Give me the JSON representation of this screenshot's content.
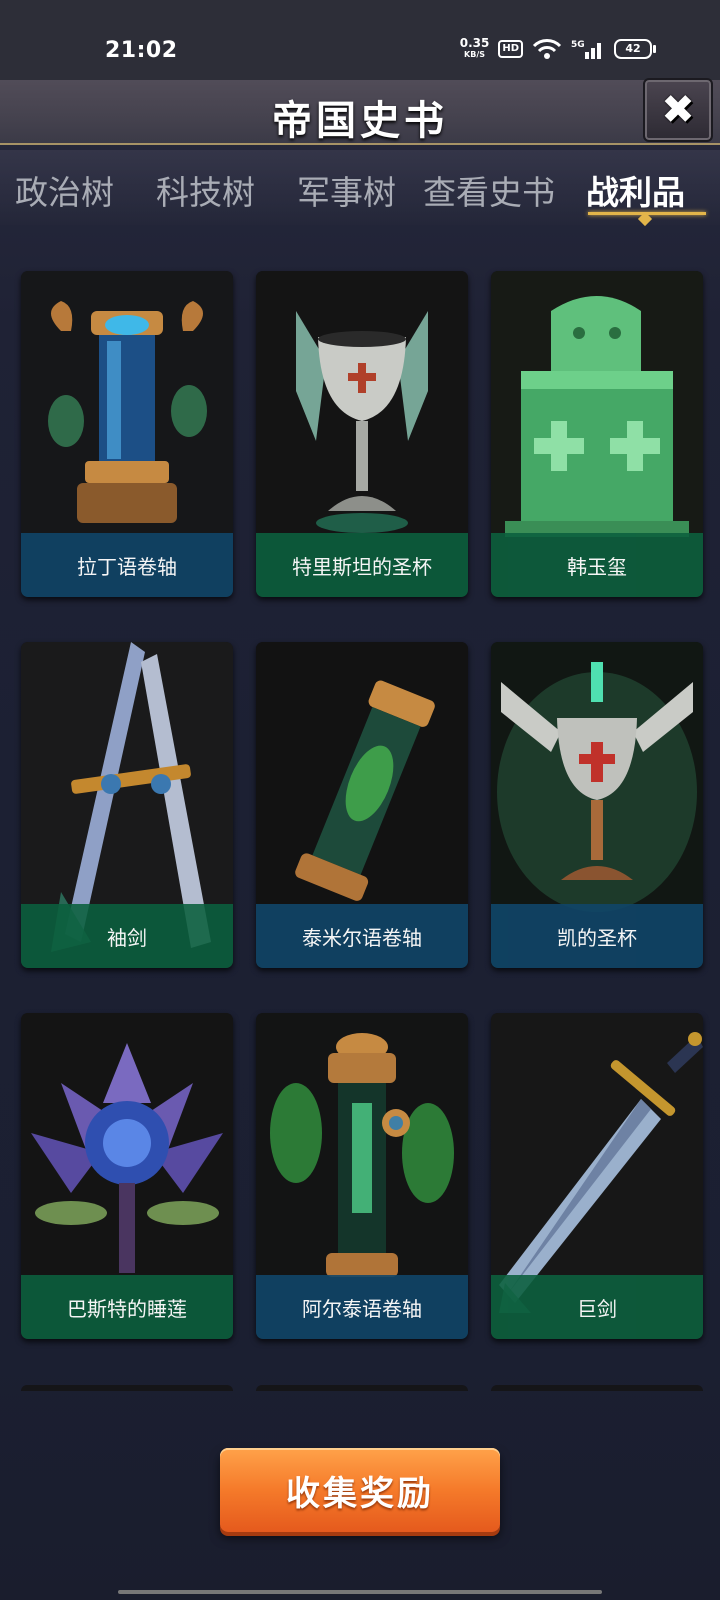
{
  "status_bar": {
    "time": "21:02",
    "net_speed": "0.35",
    "net_unit": "KB/S",
    "hd": "HD",
    "network": "5G",
    "battery": "42"
  },
  "header": {
    "title": "帝国史书",
    "close_label": "✖"
  },
  "tabs": [
    {
      "label": "政治树",
      "active": false
    },
    {
      "label": "科技树",
      "active": false
    },
    {
      "label": "军事树",
      "active": false
    },
    {
      "label": "查看史书",
      "active": false
    },
    {
      "label": "战利品",
      "active": true
    }
  ],
  "items": [
    {
      "name": "拉丁语卷轴",
      "icon": "scroll-icon",
      "label_color": "#104669"
    },
    {
      "name": "特里斯坦的圣杯",
      "icon": "grail-icon",
      "label_color": "#0c603e"
    },
    {
      "name": "韩玉玺",
      "icon": "jade-seal-icon",
      "label_color": "#0c603e"
    },
    {
      "name": "袖剑",
      "icon": "sword-icon",
      "label_color": "#0c603e"
    },
    {
      "name": "泰米尔语卷轴",
      "icon": "scroll-icon",
      "label_color": "#104669"
    },
    {
      "name": "凯的圣杯",
      "icon": "grail-icon",
      "label_color": "#104669"
    },
    {
      "name": "巴斯特的睡莲",
      "icon": "lotus-icon",
      "label_color": "#0c603e"
    },
    {
      "name": "阿尔泰语卷轴",
      "icon": "scroll-icon",
      "label_color": "#104669"
    },
    {
      "name": "巨剑",
      "icon": "sword-icon",
      "label_color": "#0c603e"
    }
  ],
  "collect_button": {
    "label": "收集奖励"
  },
  "colors": {
    "accent_gold": "#e2b54a",
    "button_orange": "#f57a2a"
  }
}
